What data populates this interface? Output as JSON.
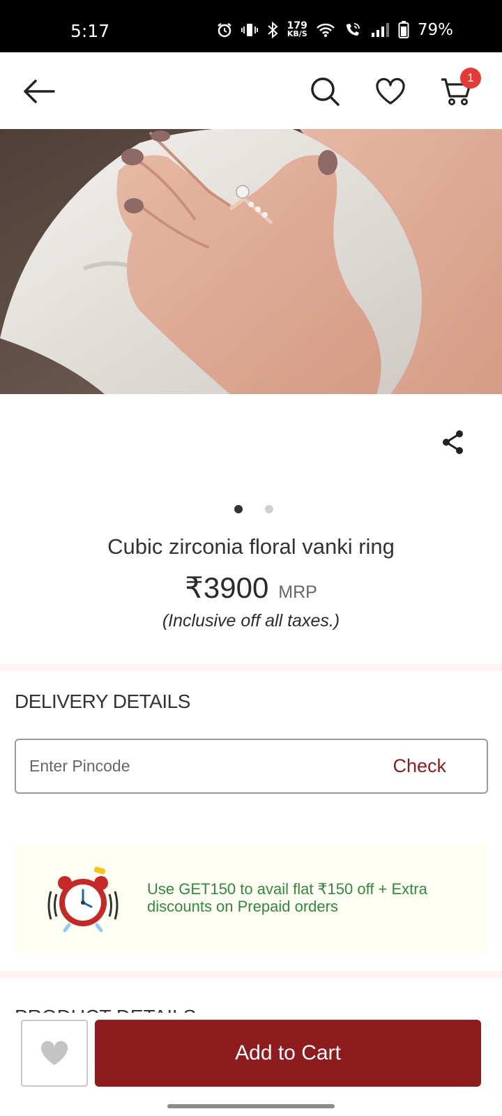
{
  "status_bar": {
    "time": "5:17",
    "speed_value": "179",
    "speed_unit": "KB/S",
    "battery": "79%"
  },
  "header": {
    "cart_count": "1"
  },
  "product": {
    "title": "Cubic zirconia floral vanki ring",
    "price": "₹3900",
    "mrp_label": "MRP",
    "tax_note": "(Inclusive off all taxes.)",
    "image_count": 2,
    "active_image": 1
  },
  "delivery": {
    "heading": "DELIVERY DETAILS",
    "pincode_placeholder": "Enter Pincode",
    "check_label": "Check"
  },
  "offer": {
    "text": "Use GET150 to avail flat ₹150 off + Extra discounts on Prepaid orders"
  },
  "product_details": {
    "heading": "PRODUCT DETAILS"
  },
  "bottom_bar": {
    "add_to_cart_label": "Add to Cart"
  },
  "colors": {
    "brand": "#8e1b1e",
    "badge": "#e53935",
    "offer_text": "#2e8b3e"
  }
}
